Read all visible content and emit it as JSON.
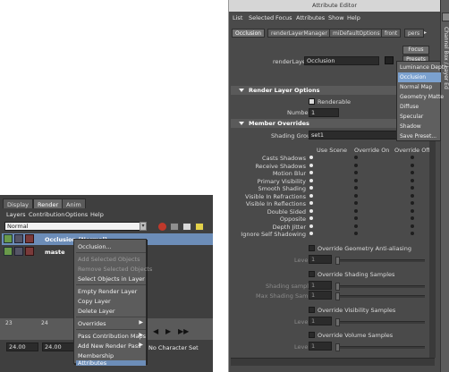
{
  "left_panel": {
    "tabs": [
      "Display",
      "Render",
      "Anim"
    ],
    "menu": [
      "Layers",
      "Contribution",
      "Options",
      "Help"
    ],
    "blend_mode": "Normal",
    "layers": [
      "Occlusion (Normal)",
      "maste"
    ],
    "timeline": {
      "ticks": [
        "23",
        "24"
      ],
      "value": "24.00",
      "value2": "24.00",
      "character_set": "No Character Set"
    }
  },
  "context_menu": {
    "items": [
      {
        "label": "Occlusion...",
        "state": "normal"
      },
      {
        "label": "Add Selected Objects",
        "state": "disabled"
      },
      {
        "label": "Remove Selected Objects",
        "state": "disabled"
      },
      {
        "label": "Select Objects in Layer",
        "state": "normal"
      },
      {
        "label": "Empty Render Layer",
        "state": "normal"
      },
      {
        "label": "Copy Layer",
        "state": "normal"
      },
      {
        "label": "Delete Layer",
        "state": "normal"
      },
      {
        "label": "Overrides",
        "state": "submenu"
      },
      {
        "label": "Pass Contribution Maps",
        "state": "submenu"
      },
      {
        "label": "Add New Render Pass",
        "state": "submenu"
      },
      {
        "label": "Membership",
        "state": "normal"
      },
      {
        "label": "Attributes",
        "state": "highlighted"
      }
    ]
  },
  "attr_editor": {
    "title": "Attribute Editor",
    "menu": [
      "List",
      "Selected",
      "Focus",
      "Attributes",
      "Show",
      "Help"
    ],
    "tabs": [
      "Occlusion",
      "renderLayerManager",
      "miDefaultOptions",
      "front",
      "pers"
    ],
    "side_strip": "Channel Box / Layer Ed",
    "focus_button": "Focus",
    "presets_button": "Presets",
    "render_layer_label": "renderLayer:",
    "render_layer_value": "Occlusion",
    "section1": "Render Layer Options",
    "renderable_label": "Renderable",
    "number_label": "Number",
    "number_value": "1",
    "section2": "Member Overrides",
    "shading_group_label": "Shading Group",
    "shading_group_value": "set1",
    "col_headers": [
      "Use Scene",
      "Override On",
      "Override Off"
    ],
    "overrides": [
      "Casts Shadows",
      "Receive Shadows",
      "Motion Blur",
      "Primary Visibility",
      "Smooth Shading",
      "Visible In Refractions",
      "Visible In Reflections",
      "Double Sided",
      "Opposite",
      "Depth Jitter",
      "Ignore Self Shadowing"
    ],
    "override_geo_aa": "Override Geometry Anti-aliasing",
    "level_label": "Level",
    "level_value": "1",
    "override_shading_samples": "Override Shading Samples",
    "shading_samples_label": "Shading samples",
    "shading_samples_value": "1",
    "max_shading_samples_label": "Max Shading Samples",
    "max_shading_samples_value": "1",
    "override_visibility_samples": "Override Visibility Samples",
    "override_volume_samples": "Override Volume Samples"
  },
  "presets_dropdown": {
    "items": [
      "Luminance Depth",
      "Occlusion",
      "Normal Map",
      "Geometry Matte",
      "Diffuse",
      "Specular",
      "Shadow",
      "Save Preset..."
    ],
    "selected": "Occlusion"
  }
}
